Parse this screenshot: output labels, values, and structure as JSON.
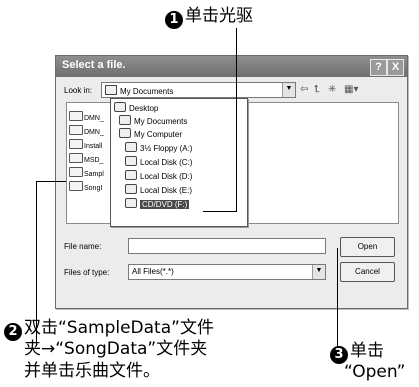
{
  "annotations": {
    "step1": {
      "num": "1",
      "text": "单击光驱"
    },
    "step2": {
      "num": "2",
      "line1": "双击“SampleData”文件",
      "line2": "夹→“SongData”文件夹",
      "line3": "并单击乐曲文件。"
    },
    "step3": {
      "num": "3",
      "line1": "单击",
      "line2": "“Open”"
    }
  },
  "dialog": {
    "title": "Select a file.",
    "help_btn": "?",
    "close_btn": "X",
    "look_in_label": "Look in:",
    "look_in_value": "My Documents",
    "file_list": [
      "DMN_",
      "DMN_",
      "Install",
      "MSD_",
      "Sampl",
      "SongI"
    ],
    "dropdown_items": [
      "Desktop",
      "My Documents",
      "My Computer",
      "3½ Floppy (A:)",
      "Local Disk (C:)",
      "Local Disk (D:)",
      "Local Disk (E:)",
      "CD/DVD (F:)"
    ],
    "file_name_label": "File name:",
    "file_name_value": "",
    "files_of_type_label": "Files of type:",
    "files_of_type_value": "All Files(*.*)",
    "open_button": "Open",
    "cancel_button": "Cancel"
  }
}
